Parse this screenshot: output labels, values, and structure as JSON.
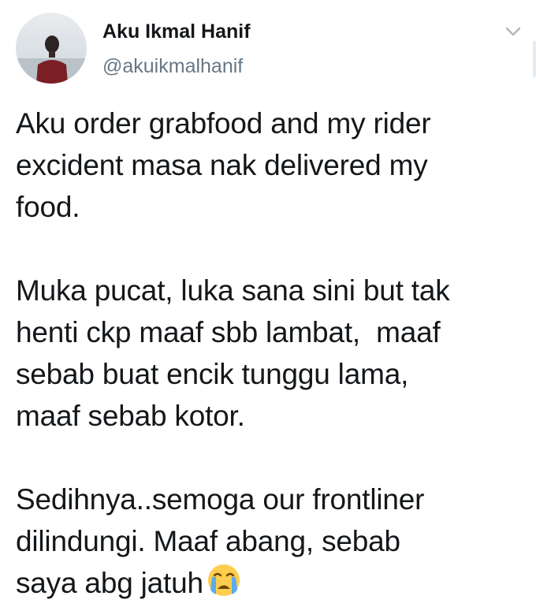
{
  "user": {
    "display_name": "Aku Ikmal Hanif",
    "handle": "@akuikmalhanif"
  },
  "tweet": {
    "paragraphs": [
      [
        "Aku order grabfood and my rider",
        "excident masa nak delivered my",
        "food."
      ],
      [
        "Muka pucat, luka sana sini but tak",
        "henti ckp maaf sbb lambat,  maaf",
        "sebab buat encik tunggu lama,",
        "maaf sebab kotor."
      ],
      [
        "Sedihnya..semoga our frontliner",
        "dilindungi. Maaf abang, sebab",
        "saya abg jatuh"
      ]
    ],
    "emoji": "loudly-crying-face-emoji"
  },
  "icons": {
    "avatar": "profile-photo",
    "menu": "chevron-down-icon"
  },
  "colors": {
    "text_primary": "#14171a",
    "text_secondary": "#657786",
    "chevron": "#aab8c2"
  }
}
